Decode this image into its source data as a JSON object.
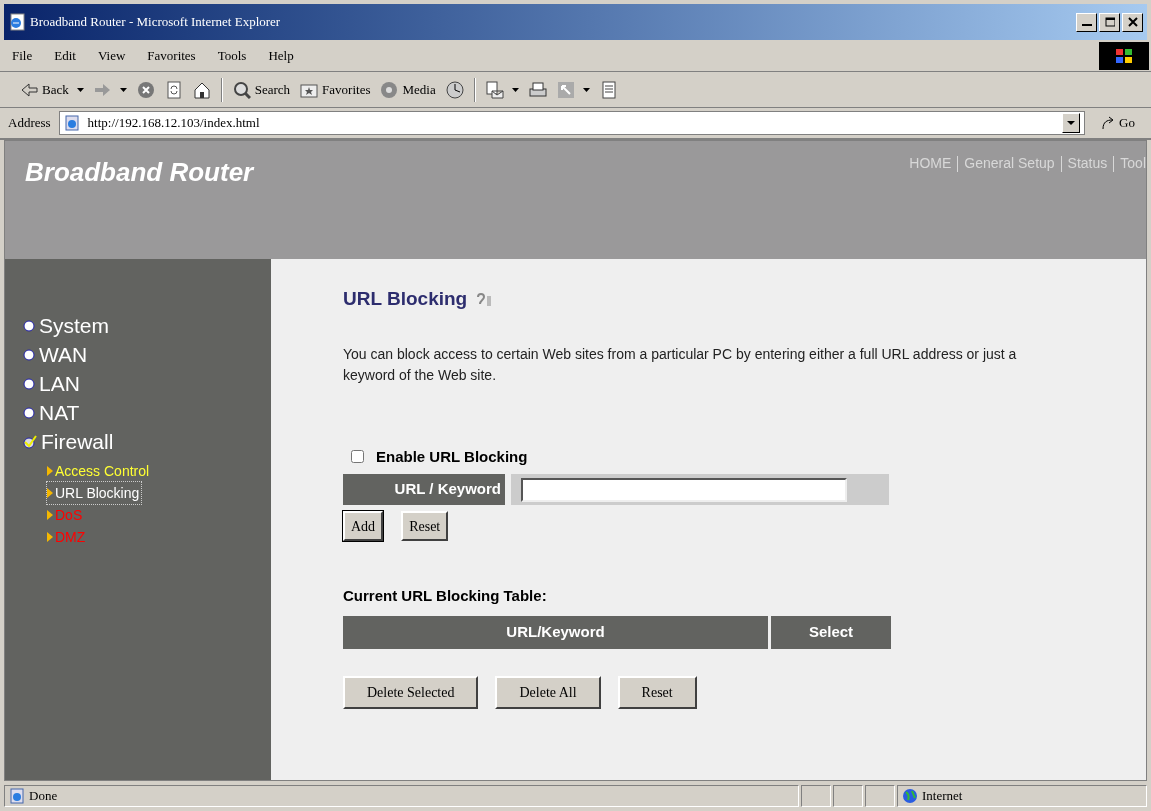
{
  "window": {
    "title": "Broadband Router - Microsoft Internet Explorer"
  },
  "menu": [
    "File",
    "Edit",
    "View",
    "Favorites",
    "Tools",
    "Help"
  ],
  "toolbar": [
    {
      "kind": "back",
      "label": "Back"
    },
    {
      "kind": "forward"
    },
    {
      "kind": "stop"
    },
    {
      "kind": "refresh"
    },
    {
      "kind": "home"
    },
    {
      "kind": "search",
      "label": "Search"
    },
    {
      "kind": "favorites",
      "label": "Favorites"
    },
    {
      "kind": "media",
      "label": "Media"
    },
    {
      "kind": "history"
    },
    {
      "kind": "mail"
    },
    {
      "kind": "print"
    },
    {
      "kind": "edit"
    },
    {
      "kind": "discuss"
    }
  ],
  "address": {
    "label": "Address",
    "value": "http://192.168.12.103/index.html",
    "go": "Go"
  },
  "header": {
    "brand": "Broadband Router",
    "nav": [
      "HOME",
      "General Setup",
      "Status",
      "Tool"
    ]
  },
  "sidebar": {
    "items": [
      {
        "label": "System",
        "expanded": false
      },
      {
        "label": "WAN",
        "expanded": false
      },
      {
        "label": "LAN",
        "expanded": false
      },
      {
        "label": "NAT",
        "expanded": false
      },
      {
        "label": "Firewall",
        "expanded": true,
        "children": [
          {
            "label": "Access Control",
            "color": "#ffff33",
            "selected": false
          },
          {
            "label": "URL Blocking",
            "color": "#ffffff",
            "selected": true
          },
          {
            "label": "DoS",
            "color": "#ff0000",
            "selected": false
          },
          {
            "label": "DMZ",
            "color": "#ff0000",
            "selected": false
          }
        ]
      }
    ]
  },
  "content": {
    "title": "URL Blocking",
    "description": "You can block access to certain Web sites from a particular PC by entering either a full URL address or just a keyword of the Web site.",
    "enable": {
      "label": "Enable URL Blocking",
      "checked": false
    },
    "field": {
      "label": "URL / Keyword"
    },
    "form_buttons": [
      "Add",
      "Reset"
    ],
    "table_title": "Current URL Blocking Table:",
    "table": {
      "columns": [
        "URL/Keyword",
        "Select"
      ]
    },
    "table_buttons": [
      "Delete Selected",
      "Delete All",
      "Reset"
    ]
  },
  "status_bar": {
    "text": "Done",
    "zone": "Internet"
  }
}
